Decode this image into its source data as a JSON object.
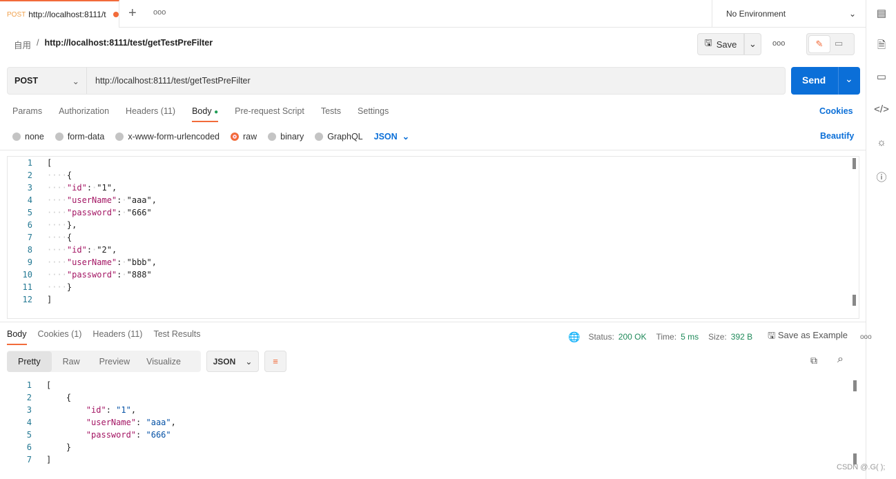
{
  "tab": {
    "method": "POST",
    "title": "http://localhost:8111/t",
    "new_tab": "+",
    "more": "ooo"
  },
  "environment": "No Environment",
  "breadcrumb": {
    "collection": "自用",
    "separator": "/",
    "name": "http://localhost:8111/test/getTestPreFilter"
  },
  "toolbar": {
    "save": "Save",
    "more": "ooo"
  },
  "request": {
    "method": "POST",
    "url": "http://localhost:8111/test/getTestPreFilter",
    "send": "Send"
  },
  "request_tabs": [
    "Params",
    "Authorization",
    "Headers (11)",
    "Body",
    "Pre-request Script",
    "Tests",
    "Settings"
  ],
  "cookies": "Cookies",
  "body_types": [
    "none",
    "form-data",
    "x-www-form-urlencoded",
    "raw",
    "binary",
    "GraphQL"
  ],
  "body_format": "JSON",
  "beautify": "Beautify",
  "request_body": [
    "[",
    "····{",
    "····\"id\":·\"1\",",
    "····\"userName\":·\"aaa\",",
    "····\"password\":·\"666\"",
    "····},",
    "····{",
    "····\"id\":·\"2\",",
    "····\"userName\":·\"bbb\",",
    "····\"password\":·\"888\"",
    "····}",
    "]"
  ],
  "response_tabs": [
    "Body",
    "Cookies (1)",
    "Headers (11)",
    "Test Results"
  ],
  "response_meta": {
    "status_label": "Status:",
    "status": "200 OK",
    "time_label": "Time:",
    "time": "5 ms",
    "size_label": "Size:",
    "size": "392 B",
    "save_example": "Save as Example",
    "more": "ooo"
  },
  "view_modes": [
    "Pretty",
    "Raw",
    "Preview",
    "Visualize"
  ],
  "response_format": "JSON",
  "response_body": [
    "[",
    "    {",
    "        \"id\": \"1\",",
    "        \"userName\": \"aaa\",",
    "        \"password\": \"666\"",
    "    }",
    "]"
  ],
  "watermark": "CSDN @.G( );"
}
